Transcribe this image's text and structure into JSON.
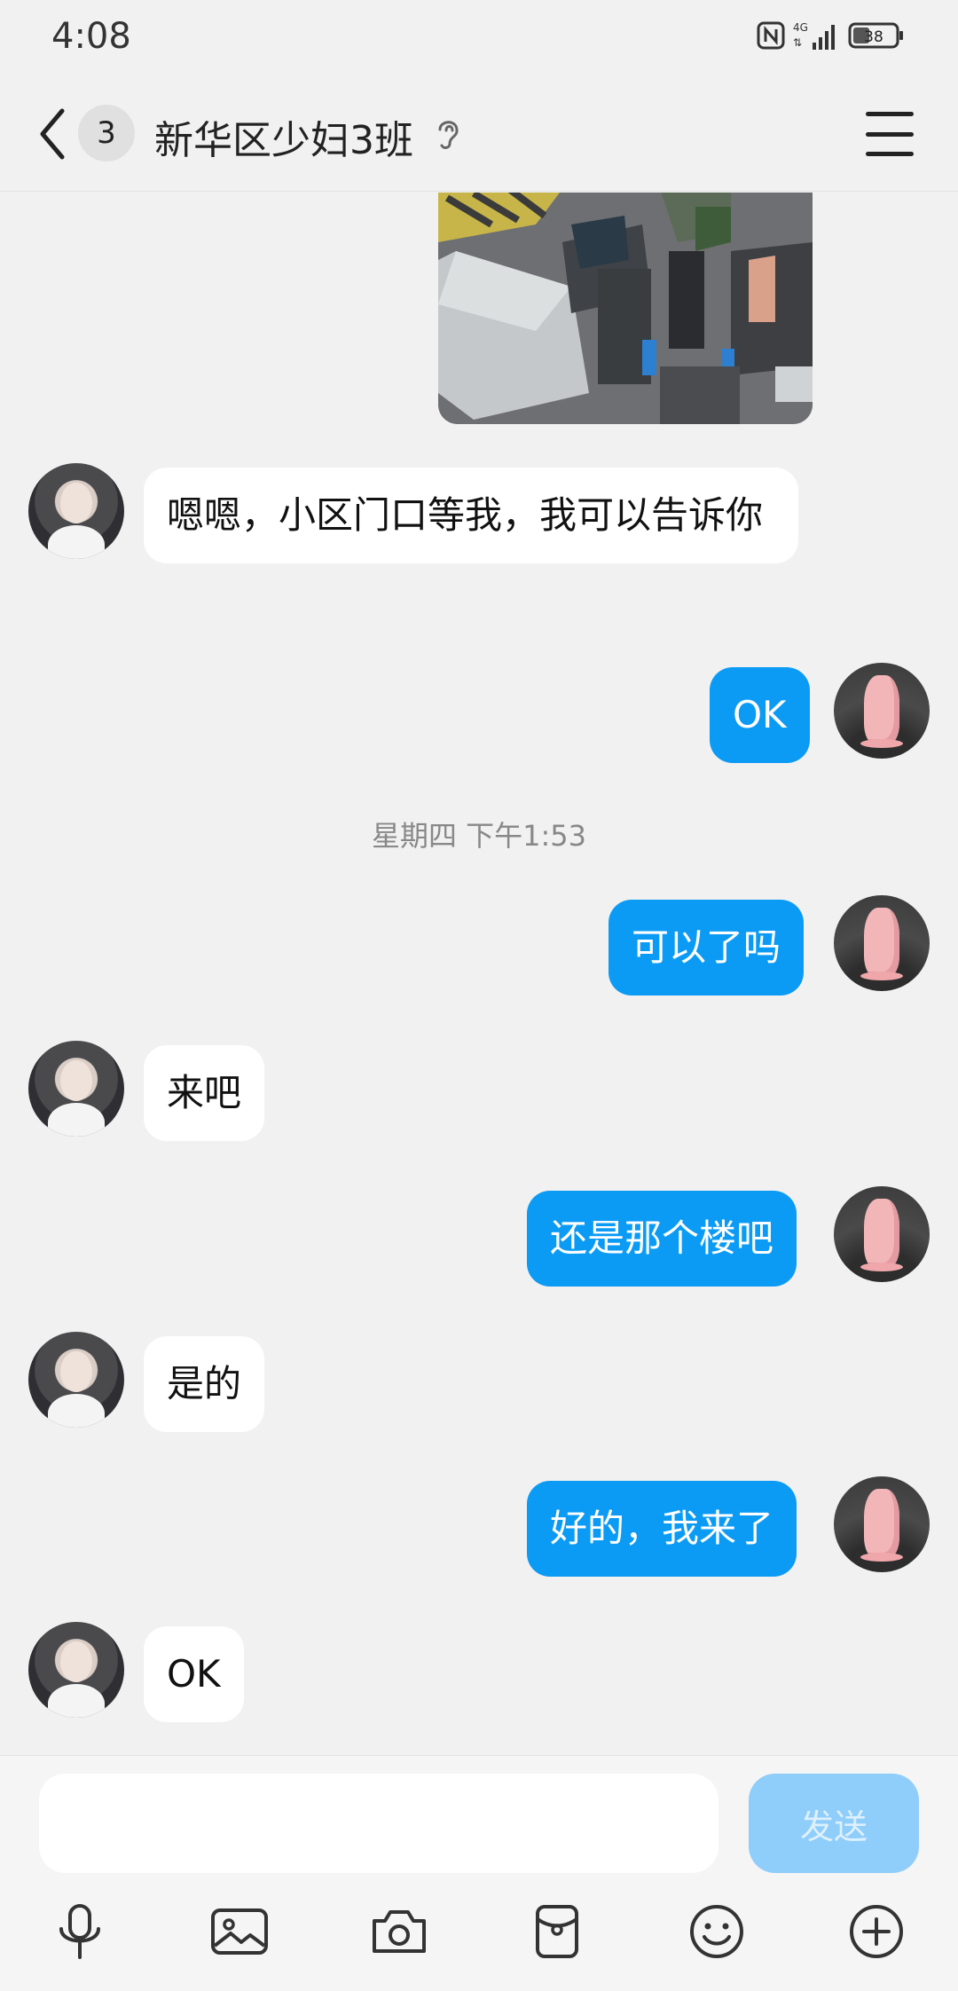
{
  "status_bar": {
    "time": "4:08",
    "network": "4G",
    "battery": "38"
  },
  "header": {
    "unread_count": "3",
    "title": "新华区少妇3班"
  },
  "messages": [
    {
      "side": "in",
      "text": "嗯嗯，小区门口等我，我可以告诉你"
    },
    {
      "side": "out",
      "text": "OK"
    },
    {
      "side": "out",
      "text": "可以了吗"
    },
    {
      "side": "in",
      "text": "来吧"
    },
    {
      "side": "out",
      "text": "还是那个楼吧"
    },
    {
      "side": "in",
      "text": "是的"
    },
    {
      "side": "out",
      "text": "好的，我来了"
    },
    {
      "side": "in",
      "text": "OK"
    }
  ],
  "timestamp": "星期四 下午1:53",
  "input": {
    "value": "",
    "send_label": "发送"
  },
  "toolbar": [
    "microphone-icon",
    "image-icon",
    "camera-icon",
    "red-packet-icon",
    "emoji-icon",
    "plus-icon"
  ],
  "colors": {
    "outgoing_bubble": "#0b9bf5",
    "send_button": "#8fcdfa",
    "background": "#f1f1f1"
  }
}
